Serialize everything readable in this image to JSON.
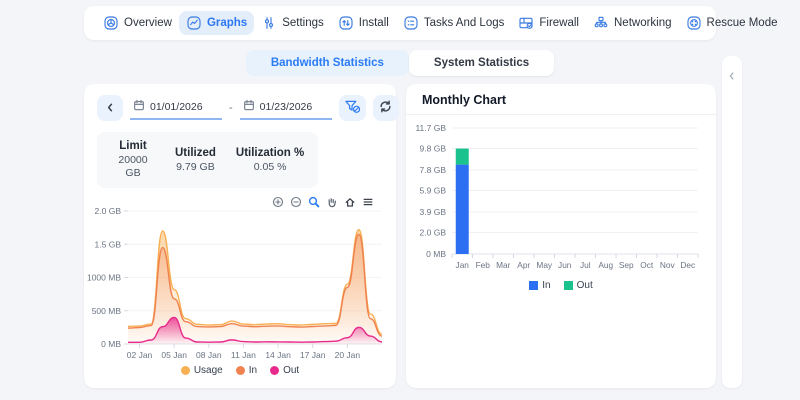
{
  "window": {
    "background": "#f4f5f8",
    "accent_color": "#2e7cf6",
    "pill_bg": "#e9f2fd"
  },
  "nav": {
    "items": [
      {
        "label": "Overview",
        "icon": "overview-icon",
        "active": false
      },
      {
        "label": "Graphs",
        "icon": "graphs-icon",
        "active": true
      },
      {
        "label": "Settings",
        "icon": "settings-icon",
        "active": false
      },
      {
        "label": "Install",
        "icon": "install-icon",
        "active": false
      },
      {
        "label": "Tasks And Logs",
        "icon": "tasks-icon",
        "active": false
      },
      {
        "label": "Firewall",
        "icon": "firewall-icon",
        "active": false
      },
      {
        "label": "Networking",
        "icon": "networking-icon",
        "active": false
      },
      {
        "label": "Rescue Mode",
        "icon": "rescue-icon",
        "active": false
      }
    ]
  },
  "tabs": {
    "items": [
      {
        "label": "Bandwidth Statistics",
        "active": true
      },
      {
        "label": "System Statistics",
        "active": false
      }
    ],
    "active_text_color": "#2b7cf7",
    "active_bg": "#e7f2fd"
  },
  "filters": {
    "date_from": "01/01/2026",
    "date_to": "01/23/2026",
    "separator": "-",
    "icons": [
      "chevron-left-icon",
      "calendar-icon",
      "filter-off-icon",
      "refresh-icon"
    ]
  },
  "summary": {
    "columns": [
      {
        "header": "Limit",
        "value": "20000 GB"
      },
      {
        "header": "Utilized",
        "value": "9.79 GB"
      },
      {
        "header": "Utilization %",
        "value": "0.05 %"
      }
    ]
  },
  "chart_toolbar": {
    "icons": [
      "zoom-in-icon",
      "zoom-out-icon",
      "selection-zoom-icon",
      "pan-icon",
      "reset-home-icon",
      "menu-icon"
    ],
    "selected": "selection-zoom-icon",
    "selected_color": "#2b7cf7"
  },
  "monthly": {
    "title": "Monthly Chart"
  },
  "side_panel": {
    "collapse_icon": "chevron-left-icon"
  },
  "chart_data": [
    {
      "type": "area",
      "title": "Daily bandwidth (01 Jan - 23 Jan 2026)",
      "x": [
        "01 Jan",
        "02 Jan",
        "03 Jan",
        "04 Jan",
        "05 Jan",
        "06 Jan",
        "07 Jan",
        "08 Jan",
        "09 Jan",
        "10 Jan",
        "11 Jan",
        "12 Jan",
        "13 Jan",
        "14 Jan",
        "15 Jan",
        "16 Jan",
        "17 Jan",
        "18 Jan",
        "19 Jan",
        "20 Jan",
        "21 Jan",
        "22 Jan",
        "23 Jan"
      ],
      "xticks": [
        "02 Jan",
        "05 Jan",
        "08 Jan",
        "11 Jan",
        "14 Jan",
        "17 Jan",
        "20 Jan"
      ],
      "yticks": [
        {
          "label": "2.0 GB",
          "mb": 2000
        },
        {
          "label": "1.5 GB",
          "mb": 1500
        },
        {
          "label": "1000 MB",
          "mb": 1000
        },
        {
          "label": "500 MB",
          "mb": 500
        },
        {
          "label": "0 MB",
          "mb": 0
        }
      ],
      "ylim_mb": [
        0,
        2000
      ],
      "unit": "MB",
      "grid": true,
      "legend_position": "bottom",
      "series": [
        {
          "name": "Usage",
          "color": "#f8b054",
          "values_mb": [
            265,
            270,
            300,
            1700,
            820,
            380,
            295,
            285,
            290,
            345,
            300,
            290,
            300,
            305,
            290,
            285,
            295,
            305,
            310,
            900,
            1720,
            450,
            150
          ]
        },
        {
          "name": "In",
          "color": "#f0824f",
          "values_mb": [
            240,
            248,
            278,
            1450,
            680,
            335,
            262,
            256,
            262,
            305,
            270,
            260,
            268,
            272,
            260,
            255,
            263,
            272,
            280,
            850,
            1650,
            380,
            120
          ]
        },
        {
          "name": "Out",
          "color": "#e72a8b",
          "values_mb": [
            25,
            26,
            60,
            260,
            400,
            90,
            30,
            28,
            30,
            62,
            36,
            30,
            33,
            31,
            30,
            28,
            30,
            36,
            42,
            95,
            250,
            120,
            32
          ]
        }
      ]
    },
    {
      "type": "bar",
      "stacked": true,
      "title": "Monthly Chart",
      "categories": [
        "Jan",
        "Feb",
        "Mar",
        "Apr",
        "May",
        "Jun",
        "Jul",
        "Aug",
        "Sep",
        "Oct",
        "Nov",
        "Dec"
      ],
      "yticks": [
        {
          "label": "11.7 GB",
          "mb": 11700
        },
        {
          "label": "9.8 GB",
          "mb": 9800
        },
        {
          "label": "7.8 GB",
          "mb": 7800
        },
        {
          "label": "5.9 GB",
          "mb": 5900
        },
        {
          "label": "3.9 GB",
          "mb": 3900
        },
        {
          "label": "2.0 GB",
          "mb": 2000
        },
        {
          "label": "0 MB",
          "mb": 0
        }
      ],
      "ylim_mb": [
        0,
        11700
      ],
      "unit": "MB",
      "grid": true,
      "legend_position": "bottom",
      "series": [
        {
          "name": "In",
          "color": "#2d6ff2",
          "values_mb": [
            8300,
            0,
            0,
            0,
            0,
            0,
            0,
            0,
            0,
            0,
            0,
            0
          ]
        },
        {
          "name": "Out",
          "color": "#1ac28d",
          "values_mb": [
            1490,
            0,
            0,
            0,
            0,
            0,
            0,
            0,
            0,
            0,
            0,
            0
          ]
        }
      ]
    }
  ]
}
